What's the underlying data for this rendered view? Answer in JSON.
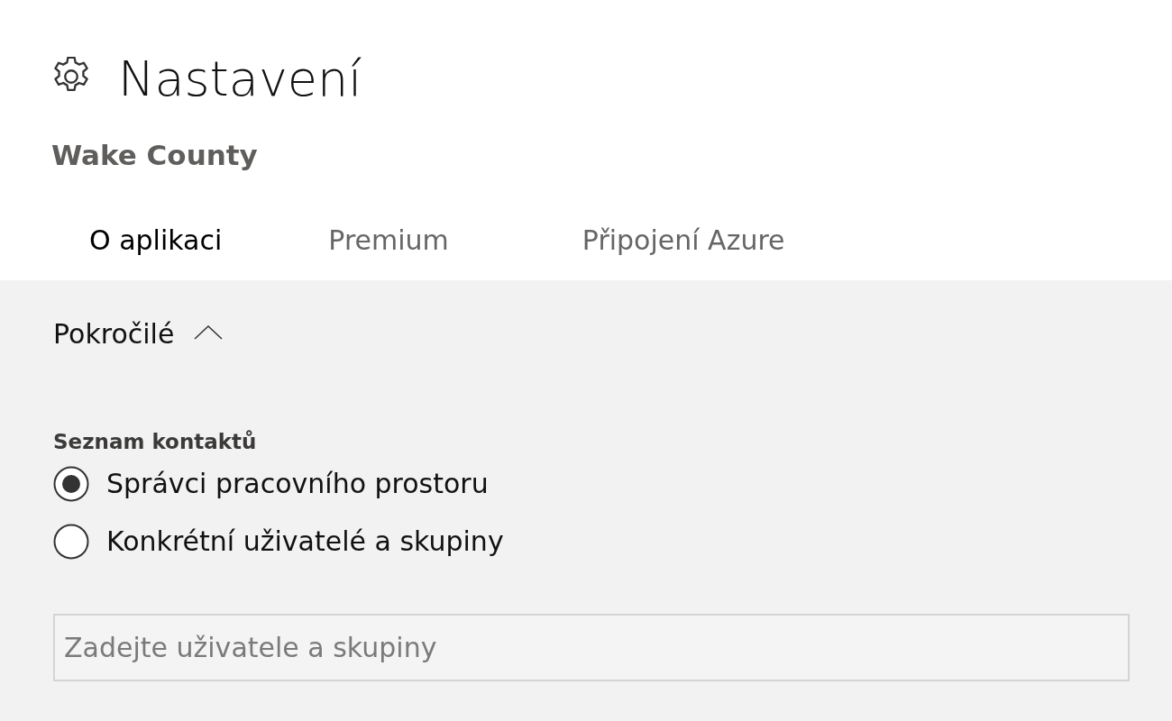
{
  "header": {
    "title": "Nastavení",
    "subtitle": "Wake County"
  },
  "tabs": [
    {
      "label": "O aplikaci",
      "selected": true
    },
    {
      "label": "Premium",
      "selected": false
    },
    {
      "label": "Připojení Azure",
      "selected": false
    }
  ],
  "section": {
    "title": "Pokročilé",
    "expanded": true
  },
  "contact_list": {
    "label": "Seznam kontaktů",
    "options": [
      {
        "label": "Správci pracovního prostoru",
        "selected": true
      },
      {
        "label": "Konkrétní uživatelé a skupiny",
        "selected": false
      }
    ],
    "input": {
      "placeholder": "Zadejte uživatele a skupiny"
    }
  }
}
